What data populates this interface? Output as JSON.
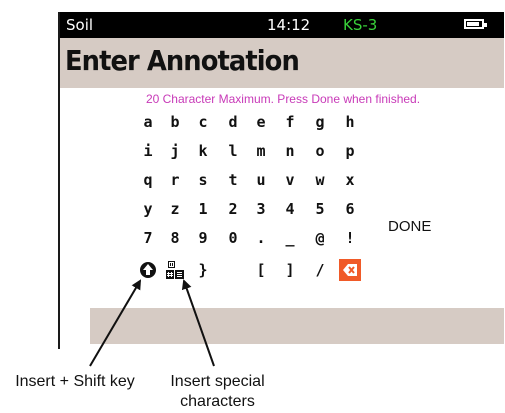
{
  "status_bar": {
    "label": "Soil",
    "time": "14:12",
    "station": "KS-3",
    "station_color": "#39d13a",
    "battery_icon": "battery-icon"
  },
  "screen": {
    "title": "Enter Annotation",
    "hint": "20 Character Maximum. Press Done when finished.",
    "hint_color": "#c83ab8",
    "keyboard_rows": [
      [
        "a",
        "b",
        "c",
        "d",
        "e",
        "f",
        "g",
        "h"
      ],
      [
        "i",
        "j",
        "k",
        "l",
        "m",
        "n",
        "o",
        "p"
      ],
      [
        "q",
        "r",
        "s",
        "t",
        "u",
        "v",
        "w",
        "x"
      ],
      [
        "y",
        "z",
        "1",
        "2",
        "3",
        "4",
        "5",
        "6"
      ],
      [
        "7",
        "8",
        "9",
        "0",
        ".",
        "_",
        "@",
        "!"
      ],
      [
        "shift-icon",
        "special-characters-icon",
        "}",
        "",
        "[",
        "]",
        "/",
        "backspace-icon"
      ]
    ],
    "done_label": "DONE",
    "backspace_color": "#f05a28",
    "panel_color": "#d6cbc4"
  },
  "annotations": {
    "shift_caption": "Insert + Shift key",
    "special_caption": "Insert special characters"
  }
}
